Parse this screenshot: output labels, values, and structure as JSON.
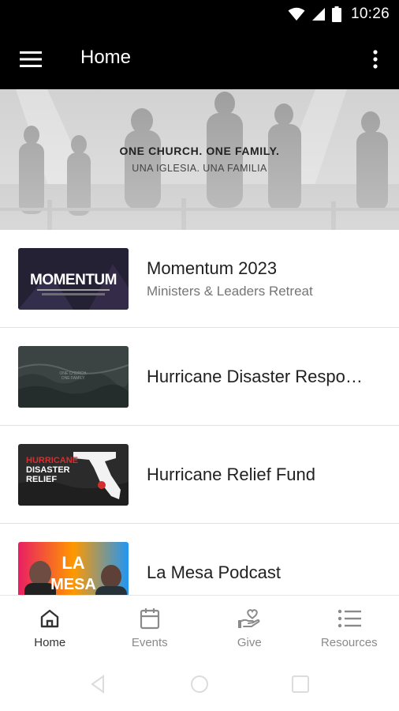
{
  "status_bar": {
    "time": "10:26"
  },
  "app_bar": {
    "title": "Home"
  },
  "banner": {
    "title": "ONE CHURCH. ONE FAMILY.",
    "subtitle": "UNA IGLESIA. UNA FAMILIA"
  },
  "items": [
    {
      "title": "Momentum 2023",
      "subtitle": "Ministers & Leaders Retreat",
      "thumb_text": "MOMENTUM"
    },
    {
      "title": "Hurricane Disaster Respo…",
      "subtitle": "",
      "thumb_text": "ONE CHURCH. ONE FAMILY."
    },
    {
      "title": "Hurricane Relief Fund",
      "subtitle": "",
      "thumb_text": "HURRICANE DISASTER RELIEF"
    },
    {
      "title": "La Mesa Podcast",
      "subtitle": "",
      "thumb_text": "LA MESA"
    }
  ],
  "bottom_nav": [
    {
      "label": "Home",
      "icon": "home-icon",
      "active": true
    },
    {
      "label": "Events",
      "icon": "calendar-icon",
      "active": false
    },
    {
      "label": "Give",
      "icon": "give-icon",
      "active": false
    },
    {
      "label": "Resources",
      "icon": "list-icon",
      "active": false
    }
  ],
  "colors": {
    "app_bar": "#000000",
    "hurricane_red": "#d32f2f"
  }
}
